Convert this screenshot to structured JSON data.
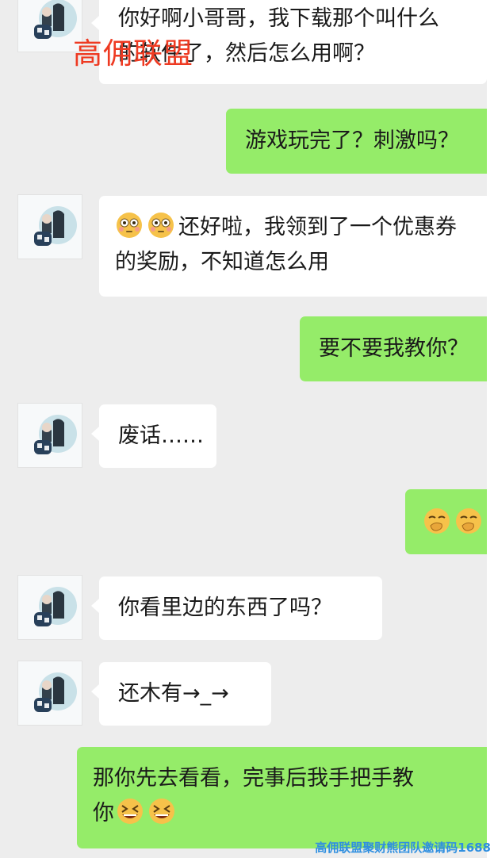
{
  "colors": {
    "chat_background": "#ededed",
    "incoming_bubble": "#ffffff",
    "outgoing_bubble": "#95ec69",
    "watermark_red": "#ee3a22",
    "watermark_blue": "#2f8fe0"
  },
  "messages": [
    {
      "direction": "in",
      "lines": [
        "你好啊小哥哥，我下载那个叫什么",
        "的软件了，然后怎么用啊？"
      ]
    },
    {
      "direction": "out",
      "lines": [
        "游戏玩完了？刺激吗？"
      ]
    },
    {
      "direction": "in",
      "emoji": "flushed-face-emoji",
      "lines": [
        "还好啦，我领到了一个优惠券",
        "的奖励，不知道怎么用"
      ]
    },
    {
      "direction": "out",
      "lines": [
        "要不要我教你？"
      ]
    },
    {
      "direction": "in",
      "lines": [
        "废话……"
      ]
    },
    {
      "direction": "out",
      "emoji": "hand-over-mouth-emoji",
      "lines": []
    },
    {
      "direction": "in",
      "lines": [
        "你看里边的东西了吗？"
      ]
    },
    {
      "direction": "in",
      "lines": [
        "还木有→_→"
      ]
    },
    {
      "direction": "out",
      "emoji": "grinning-squinting-face-emoji",
      "lines": [
        "那你先去看看，完事后我手把手教",
        "你"
      ]
    }
  ],
  "watermark": {
    "top": "高佣联盟",
    "bottom": "高佣联盟聚财熊团队邀请码1688"
  }
}
